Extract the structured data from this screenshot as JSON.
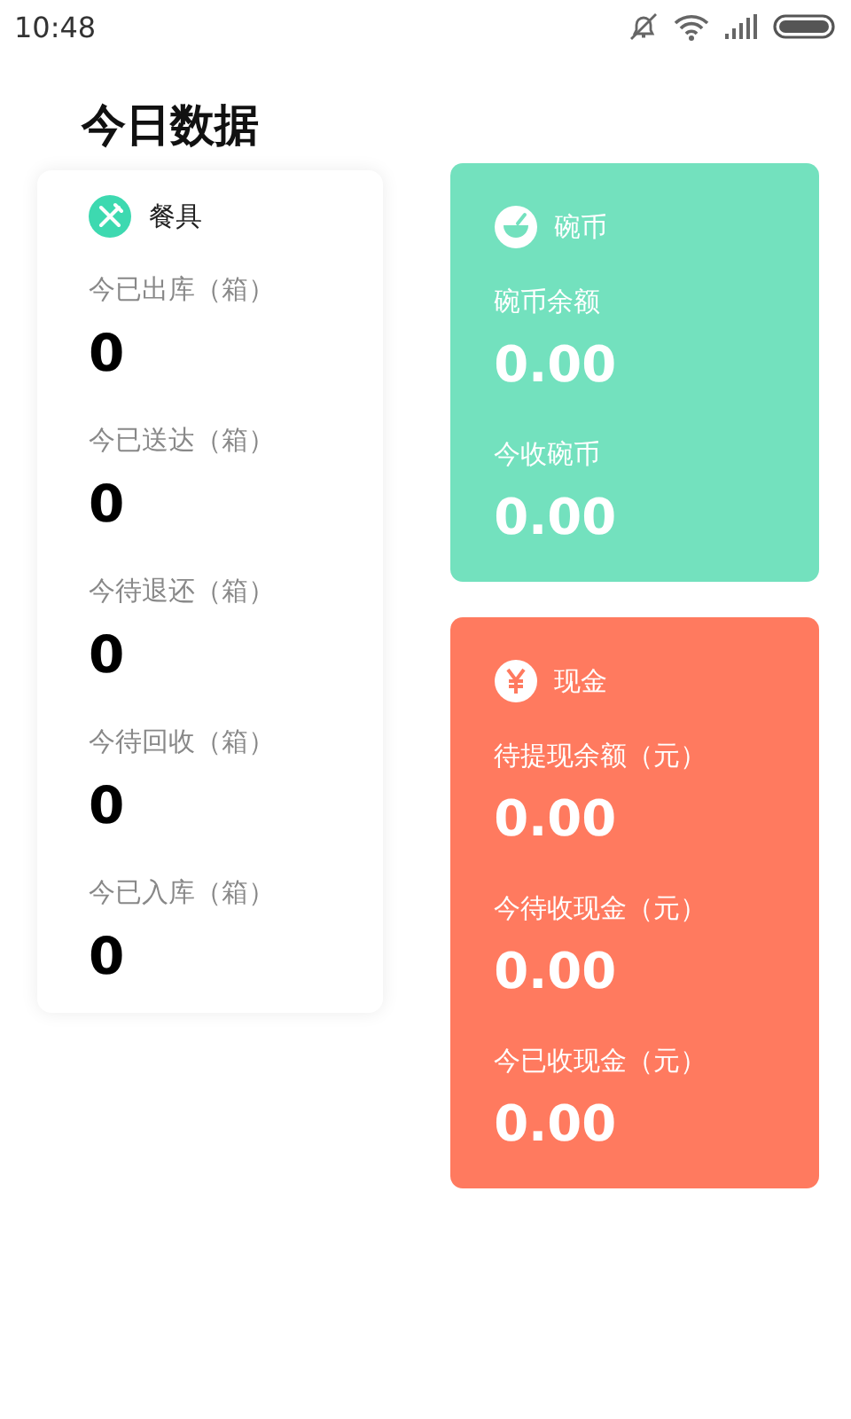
{
  "status_bar": {
    "time": "10:48"
  },
  "title": "今日数据",
  "tableware": {
    "title": "餐具",
    "stats": [
      {
        "label": "今已出库（箱）",
        "value": "0"
      },
      {
        "label": "今已送达（箱）",
        "value": "0"
      },
      {
        "label": "今待退还（箱）",
        "value": "0"
      },
      {
        "label": "今待回收（箱）",
        "value": "0"
      },
      {
        "label": "今已入库（箱）",
        "value": "0"
      }
    ]
  },
  "cards": [
    {
      "title": "碗币",
      "kind": "coin",
      "color": "#73e1be",
      "stats": [
        {
          "label": "碗币余额",
          "value": "0.00"
        },
        {
          "label": "今收碗币",
          "value": "0.00"
        }
      ]
    },
    {
      "title": "现金",
      "kind": "cash",
      "color": "#ff7a5f",
      "stats": [
        {
          "label": "待提现余额（元）",
          "value": "0.00"
        },
        {
          "label": "今待收现金（元）",
          "value": "0.00"
        },
        {
          "label": "今已收现金（元）",
          "value": "0.00"
        }
      ]
    }
  ]
}
